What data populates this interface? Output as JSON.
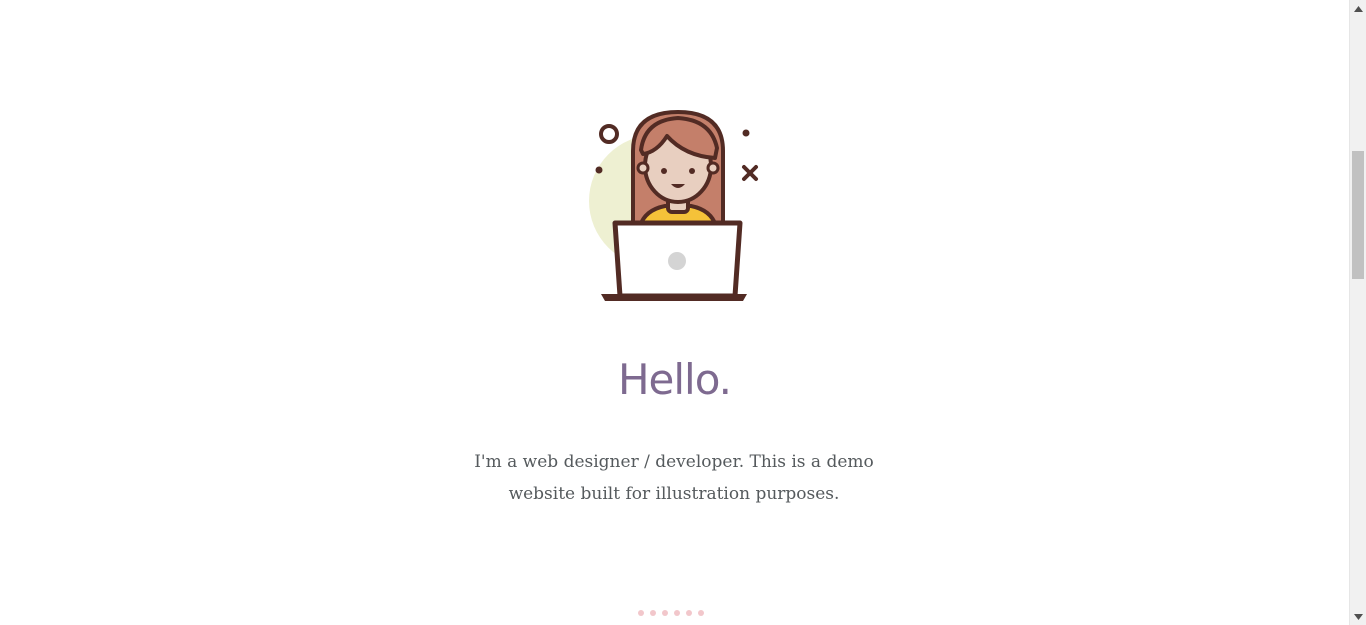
{
  "hero": {
    "title": "Hello.",
    "intro_lines": [
      "I'm a web designer / developer. This is a demo",
      "website built for illustration purposes."
    ]
  },
  "pagination": {
    "dot_count": 6
  },
  "scrollbar": {
    "position_fraction": 0.29
  },
  "colors": {
    "title": "#7e6a90",
    "text": "#555a5d",
    "dot": "#f2c7cb",
    "illustration_outline": "#522b24",
    "hair": "#c47f6a",
    "skin": "#e8cfc0",
    "circle_bg": "#eef0d2",
    "shirt": "#f5c239"
  }
}
